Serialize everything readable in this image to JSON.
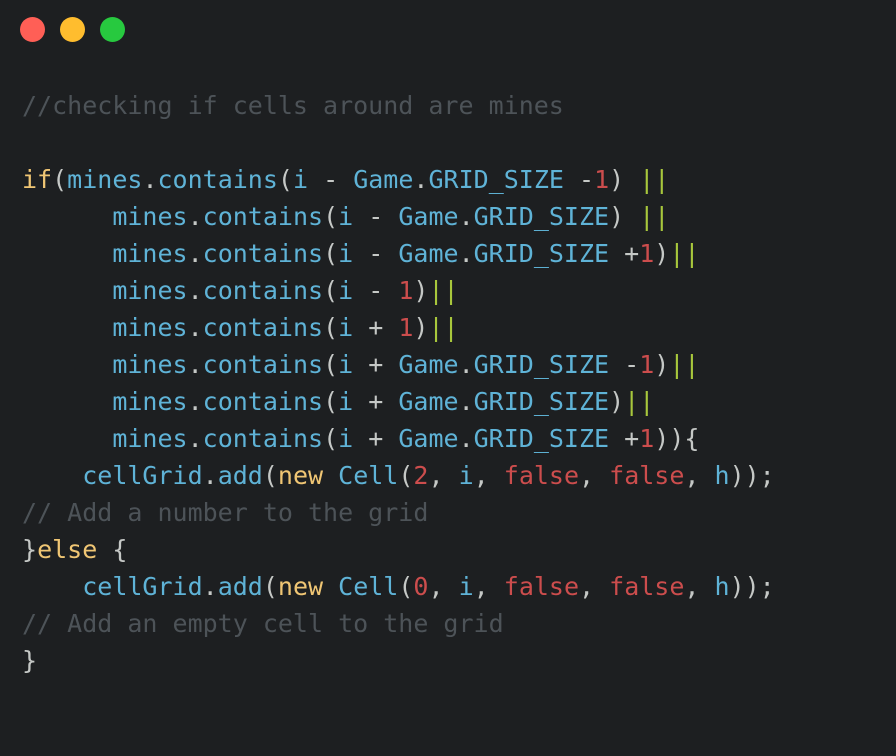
{
  "window": {
    "buttons": [
      {
        "name": "close",
        "color": "#ff5f56"
      },
      {
        "name": "minimize",
        "color": "#ffbd2e"
      },
      {
        "name": "zoom",
        "color": "#27c93f"
      }
    ]
  },
  "code": {
    "lines": [
      [
        {
          "t": "comment",
          "v": "//checking if cells around are mines"
        }
      ],
      [],
      [
        {
          "t": "keyword",
          "v": "if"
        },
        {
          "t": "punct",
          "v": "("
        },
        {
          "t": "ident",
          "v": "mines"
        },
        {
          "t": "punct",
          "v": "."
        },
        {
          "t": "ident",
          "v": "contains"
        },
        {
          "t": "punct",
          "v": "("
        },
        {
          "t": "ident",
          "v": "i"
        },
        {
          "t": "operator",
          "v": " - "
        },
        {
          "t": "ident",
          "v": "Game"
        },
        {
          "t": "punct",
          "v": "."
        },
        {
          "t": "ident",
          "v": "GRID_SIZE"
        },
        {
          "t": "operator",
          "v": " -"
        },
        {
          "t": "number",
          "v": "1"
        },
        {
          "t": "punct",
          "v": ") "
        },
        {
          "t": "logic",
          "v": "||"
        }
      ],
      [
        {
          "t": "punct",
          "v": "      "
        },
        {
          "t": "ident",
          "v": "mines"
        },
        {
          "t": "punct",
          "v": "."
        },
        {
          "t": "ident",
          "v": "contains"
        },
        {
          "t": "punct",
          "v": "("
        },
        {
          "t": "ident",
          "v": "i"
        },
        {
          "t": "operator",
          "v": " - "
        },
        {
          "t": "ident",
          "v": "Game"
        },
        {
          "t": "punct",
          "v": "."
        },
        {
          "t": "ident",
          "v": "GRID_SIZE"
        },
        {
          "t": "punct",
          "v": ") "
        },
        {
          "t": "logic",
          "v": "||"
        }
      ],
      [
        {
          "t": "punct",
          "v": "      "
        },
        {
          "t": "ident",
          "v": "mines"
        },
        {
          "t": "punct",
          "v": "."
        },
        {
          "t": "ident",
          "v": "contains"
        },
        {
          "t": "punct",
          "v": "("
        },
        {
          "t": "ident",
          "v": "i"
        },
        {
          "t": "operator",
          "v": " - "
        },
        {
          "t": "ident",
          "v": "Game"
        },
        {
          "t": "punct",
          "v": "."
        },
        {
          "t": "ident",
          "v": "GRID_SIZE"
        },
        {
          "t": "operator",
          "v": " +"
        },
        {
          "t": "number",
          "v": "1"
        },
        {
          "t": "punct",
          "v": ")"
        },
        {
          "t": "logic",
          "v": "||"
        }
      ],
      [
        {
          "t": "punct",
          "v": "      "
        },
        {
          "t": "ident",
          "v": "mines"
        },
        {
          "t": "punct",
          "v": "."
        },
        {
          "t": "ident",
          "v": "contains"
        },
        {
          "t": "punct",
          "v": "("
        },
        {
          "t": "ident",
          "v": "i"
        },
        {
          "t": "operator",
          "v": " - "
        },
        {
          "t": "number",
          "v": "1"
        },
        {
          "t": "punct",
          "v": ")"
        },
        {
          "t": "logic",
          "v": "||"
        }
      ],
      [
        {
          "t": "punct",
          "v": "      "
        },
        {
          "t": "ident",
          "v": "mines"
        },
        {
          "t": "punct",
          "v": "."
        },
        {
          "t": "ident",
          "v": "contains"
        },
        {
          "t": "punct",
          "v": "("
        },
        {
          "t": "ident",
          "v": "i"
        },
        {
          "t": "operator",
          "v": " + "
        },
        {
          "t": "number",
          "v": "1"
        },
        {
          "t": "punct",
          "v": ")"
        },
        {
          "t": "logic",
          "v": "||"
        }
      ],
      [
        {
          "t": "punct",
          "v": "      "
        },
        {
          "t": "ident",
          "v": "mines"
        },
        {
          "t": "punct",
          "v": "."
        },
        {
          "t": "ident",
          "v": "contains"
        },
        {
          "t": "punct",
          "v": "("
        },
        {
          "t": "ident",
          "v": "i"
        },
        {
          "t": "operator",
          "v": " + "
        },
        {
          "t": "ident",
          "v": "Game"
        },
        {
          "t": "punct",
          "v": "."
        },
        {
          "t": "ident",
          "v": "GRID_SIZE"
        },
        {
          "t": "operator",
          "v": " -"
        },
        {
          "t": "number",
          "v": "1"
        },
        {
          "t": "punct",
          "v": ")"
        },
        {
          "t": "logic",
          "v": "||"
        }
      ],
      [
        {
          "t": "punct",
          "v": "      "
        },
        {
          "t": "ident",
          "v": "mines"
        },
        {
          "t": "punct",
          "v": "."
        },
        {
          "t": "ident",
          "v": "contains"
        },
        {
          "t": "punct",
          "v": "("
        },
        {
          "t": "ident",
          "v": "i"
        },
        {
          "t": "operator",
          "v": " + "
        },
        {
          "t": "ident",
          "v": "Game"
        },
        {
          "t": "punct",
          "v": "."
        },
        {
          "t": "ident",
          "v": "GRID_SIZE"
        },
        {
          "t": "punct",
          "v": ")"
        },
        {
          "t": "logic",
          "v": "||"
        }
      ],
      [
        {
          "t": "punct",
          "v": "      "
        },
        {
          "t": "ident",
          "v": "mines"
        },
        {
          "t": "punct",
          "v": "."
        },
        {
          "t": "ident",
          "v": "contains"
        },
        {
          "t": "punct",
          "v": "("
        },
        {
          "t": "ident",
          "v": "i"
        },
        {
          "t": "operator",
          "v": " + "
        },
        {
          "t": "ident",
          "v": "Game"
        },
        {
          "t": "punct",
          "v": "."
        },
        {
          "t": "ident",
          "v": "GRID_SIZE"
        },
        {
          "t": "operator",
          "v": " +"
        },
        {
          "t": "number",
          "v": "1"
        },
        {
          "t": "punct",
          "v": ")){"
        }
      ],
      [
        {
          "t": "punct",
          "v": "    "
        },
        {
          "t": "ident",
          "v": "cellGrid"
        },
        {
          "t": "punct",
          "v": "."
        },
        {
          "t": "ident",
          "v": "add"
        },
        {
          "t": "punct",
          "v": "("
        },
        {
          "t": "keyword",
          "v": "new"
        },
        {
          "t": "punct",
          "v": " "
        },
        {
          "t": "ident",
          "v": "Cell"
        },
        {
          "t": "punct",
          "v": "("
        },
        {
          "t": "number",
          "v": "2"
        },
        {
          "t": "punct",
          "v": ", "
        },
        {
          "t": "ident",
          "v": "i"
        },
        {
          "t": "punct",
          "v": ", "
        },
        {
          "t": "literal",
          "v": "false"
        },
        {
          "t": "punct",
          "v": ", "
        },
        {
          "t": "literal",
          "v": "false"
        },
        {
          "t": "punct",
          "v": ", "
        },
        {
          "t": "ident",
          "v": "h"
        },
        {
          "t": "punct",
          "v": "));"
        }
      ],
      [
        {
          "t": "comment",
          "v": "// Add a number to the grid"
        }
      ],
      [
        {
          "t": "punct",
          "v": "}"
        },
        {
          "t": "keyword",
          "v": "else"
        },
        {
          "t": "punct",
          "v": " {"
        }
      ],
      [
        {
          "t": "punct",
          "v": "    "
        },
        {
          "t": "ident",
          "v": "cellGrid"
        },
        {
          "t": "punct",
          "v": "."
        },
        {
          "t": "ident",
          "v": "add"
        },
        {
          "t": "punct",
          "v": "("
        },
        {
          "t": "keyword",
          "v": "new"
        },
        {
          "t": "punct",
          "v": " "
        },
        {
          "t": "ident",
          "v": "Cell"
        },
        {
          "t": "punct",
          "v": "("
        },
        {
          "t": "number",
          "v": "0"
        },
        {
          "t": "punct",
          "v": ", "
        },
        {
          "t": "ident",
          "v": "i"
        },
        {
          "t": "punct",
          "v": ", "
        },
        {
          "t": "literal",
          "v": "false"
        },
        {
          "t": "punct",
          "v": ", "
        },
        {
          "t": "literal",
          "v": "false"
        },
        {
          "t": "punct",
          "v": ", "
        },
        {
          "t": "ident",
          "v": "h"
        },
        {
          "t": "punct",
          "v": "));"
        }
      ],
      [
        {
          "t": "comment",
          "v": "// Add an empty cell to the grid"
        }
      ],
      [
        {
          "t": "punct",
          "v": "}"
        }
      ]
    ]
  }
}
